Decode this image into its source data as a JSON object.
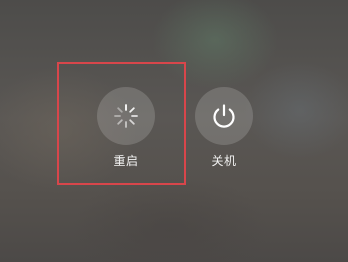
{
  "power_menu": {
    "actions": [
      {
        "label": "重启",
        "icon": "reboot-spinner-icon"
      },
      {
        "label": "关机",
        "icon": "power-icon"
      }
    ]
  },
  "highlight": {
    "color": "#d8464b",
    "target": "重启"
  }
}
